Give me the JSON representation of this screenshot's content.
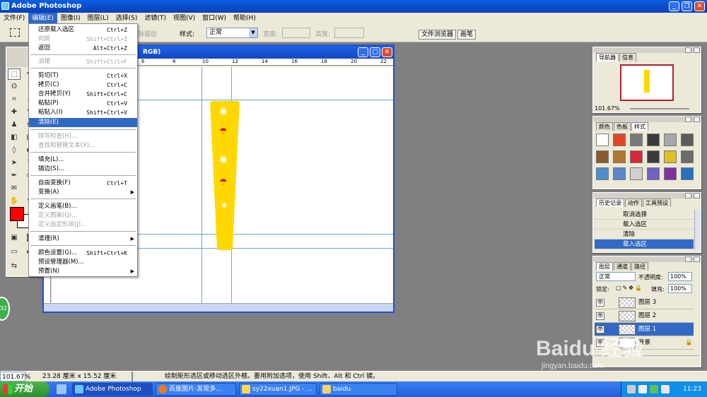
{
  "app": {
    "title": "Adobe Photoshop"
  },
  "menubar": {
    "items": [
      "文件(F)",
      "编辑(E)",
      "图像(I)",
      "图层(L)",
      "选择(S)",
      "滤镜(T)",
      "视图(V)",
      "窗口(W)",
      "帮助(H)"
    ]
  },
  "options": {
    "partial_label": "除锯齿",
    "style_label": "样式:",
    "style_value": "正常",
    "width_label": "宽度:",
    "height_label": "高度:",
    "file_browser_tab": "文件浏览器",
    "brushes_tab": "画笔"
  },
  "document": {
    "title_partial": "RGB)",
    "ruler_ticks": [
      "6",
      "8",
      "10",
      "12",
      "14",
      "16",
      "18",
      "20",
      "22"
    ]
  },
  "edit_menu": {
    "items": [
      {
        "label": "还原载入选区",
        "shortcut": "Ctrl+Z",
        "disabled": false
      },
      {
        "label": "向前",
        "shortcut": "Shift+Ctrl+Z",
        "disabled": true
      },
      {
        "label": "返回",
        "shortcut": "Alt+Ctrl+Z",
        "disabled": false
      },
      {
        "label": "消褪",
        "shortcut": "Shift+Ctrl+F",
        "disabled": true
      },
      {
        "label": "剪切(T)",
        "shortcut": "Ctrl+X",
        "disabled": false
      },
      {
        "label": "拷贝(C)",
        "shortcut": "Ctrl+C",
        "disabled": false
      },
      {
        "label": "合并拷贝(Y)",
        "shortcut": "Shift+Ctrl+C",
        "disabled": false
      },
      {
        "label": "粘贴(P)",
        "shortcut": "Ctrl+V",
        "disabled": false
      },
      {
        "label": "粘贴入(I)",
        "shortcut": "Shift+Ctrl+V",
        "disabled": false
      },
      {
        "label": "清除(E)",
        "shortcut": "",
        "disabled": false,
        "highlighted": true
      },
      {
        "label": "拼写检查(H)...",
        "shortcut": "",
        "disabled": true
      },
      {
        "label": "查找和替换文本(X)...",
        "shortcut": "",
        "disabled": true
      },
      {
        "label": "填充(L)...",
        "shortcut": "",
        "disabled": false
      },
      {
        "label": "描边(S)...",
        "shortcut": "",
        "disabled": false
      },
      {
        "label": "自由变换(F)",
        "shortcut": "Ctrl+T",
        "disabled": false
      },
      {
        "label": "变换(A)",
        "shortcut": "",
        "disabled": false,
        "submenu": true
      },
      {
        "label": "定义画笔(B)...",
        "shortcut": "",
        "disabled": false
      },
      {
        "label": "定义图案(Q)...",
        "shortcut": "",
        "disabled": true
      },
      {
        "label": "定义自定形状(J)...",
        "shortcut": "",
        "disabled": true
      },
      {
        "label": "清理(R)",
        "shortcut": "",
        "disabled": false,
        "submenu": true
      },
      {
        "label": "颜色设置(G)...",
        "shortcut": "Shift+Ctrl+K",
        "disabled": false
      },
      {
        "label": "预设管理器(M)...",
        "shortcut": "",
        "disabled": false
      },
      {
        "label": "预置(N)",
        "shortcut": "",
        "disabled": false,
        "submenu": true
      }
    ]
  },
  "navigator": {
    "tabs": [
      "导航器",
      "信息"
    ],
    "zoom": "101.67%"
  },
  "swatches": {
    "tabs": [
      "颜色",
      "色板",
      "样式"
    ],
    "colors": [
      "#ffffff",
      "#e0472a",
      "#7a7a7a",
      "#3a3a3a",
      "#a8a8a8",
      "#5c5c5c",
      "#8a5a2a",
      "#b07830",
      "#d8283a",
      "#3c3c3c",
      "#e0c020",
      "#6c6c6c",
      "#4a90d0",
      "#5a88c8",
      "#d0d0d0",
      "#7060c0",
      "#8030a0",
      "#2a70c0"
    ]
  },
  "history": {
    "tabs": [
      "历史记录",
      "动作",
      "工具预设"
    ],
    "items": [
      "取消选择",
      "载入选区",
      "清除",
      "载入选区"
    ]
  },
  "layers": {
    "tabs": [
      "图层",
      "通道",
      "路径"
    ],
    "blend_mode": "正常",
    "opacity_label": "不透明度:",
    "opacity_value": "100%",
    "lock_label": "锁定:",
    "fill_label": "填充:",
    "fill_value": "100%",
    "items": [
      "图层 3",
      "图层 2",
      "图层 1",
      "背景"
    ]
  },
  "statusbar": {
    "zoom": "101.67%",
    "doc_size": "23.28 厘米 x 15.52 厘米",
    "hint": "绘制矩形选区或移动选区外框。要用附加选项，使用 Shift、Alt 和 Ctrl 键。"
  },
  "taskbar": {
    "start": "开始",
    "buttons": [
      "Adobe Photoshop",
      "百度图片-发现多...",
      "sy22xuan1.JPG - ...",
      "baidu"
    ],
    "clock": "11:23"
  },
  "watermark": {
    "line1": "Baidu 经验",
    "line2": "jingyan.baidu.com"
  },
  "badge": "32",
  "colors": {
    "accent": "#316ac5",
    "yellow_shape": "#ffd800",
    "foreground": "#ff0000"
  }
}
